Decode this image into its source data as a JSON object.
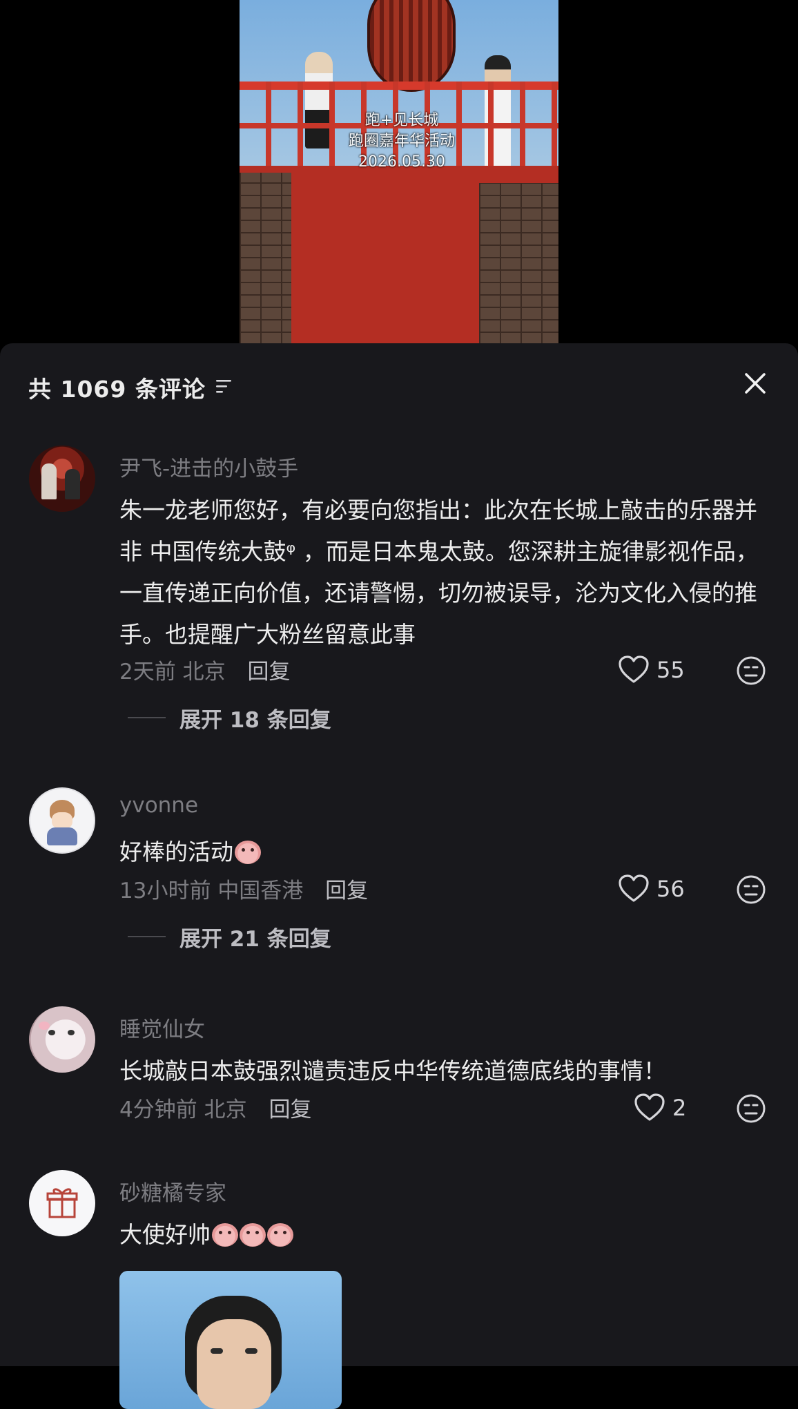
{
  "video": {
    "overlay_line1": "跑+见长城",
    "overlay_line2": "跑圈嘉年华活动",
    "overlay_date": "2026.05.30"
  },
  "comments_sheet": {
    "title": "共 1069 条评论",
    "filter_icon": "filter-icon",
    "close_icon": "close-icon"
  },
  "comments": [
    {
      "username": "尹飞-进击的小鼓手",
      "text": "朱一龙老师您好，有必要向您指出：此次在长城上敲击的乐器并非 中国传统大鼓ᵠ ，而是日本鬼太鼓。您深耕主旋律影视作品，一直传递正向价值，还请警惕，切勿被误导，沦为文化入侵的推手。也提醒广大粉丝留意此事",
      "time": "2天前",
      "location": "北京",
      "reply_label": "回复",
      "likes": "55",
      "expand_label": "展开 18 条回复"
    },
    {
      "username": "yvonne",
      "text": "好棒的活动",
      "time": "13小时前",
      "location": "中国香港",
      "reply_label": "回复",
      "likes": "56",
      "expand_label": "展开 21 条回复"
    },
    {
      "username": "睡觉仙女",
      "text": "长城敲日本鼓强烈谴责违反中华传统道德底线的事情！",
      "time": "4分钟前",
      "location": "北京",
      "reply_label": "回复",
      "likes": "2"
    },
    {
      "username": "砂糖橘专家",
      "text": "大使好帅"
    }
  ],
  "colors": {
    "sheet_bg": "#18181c",
    "text_primary": "#ededed",
    "text_secondary": "#7d7d82"
  }
}
